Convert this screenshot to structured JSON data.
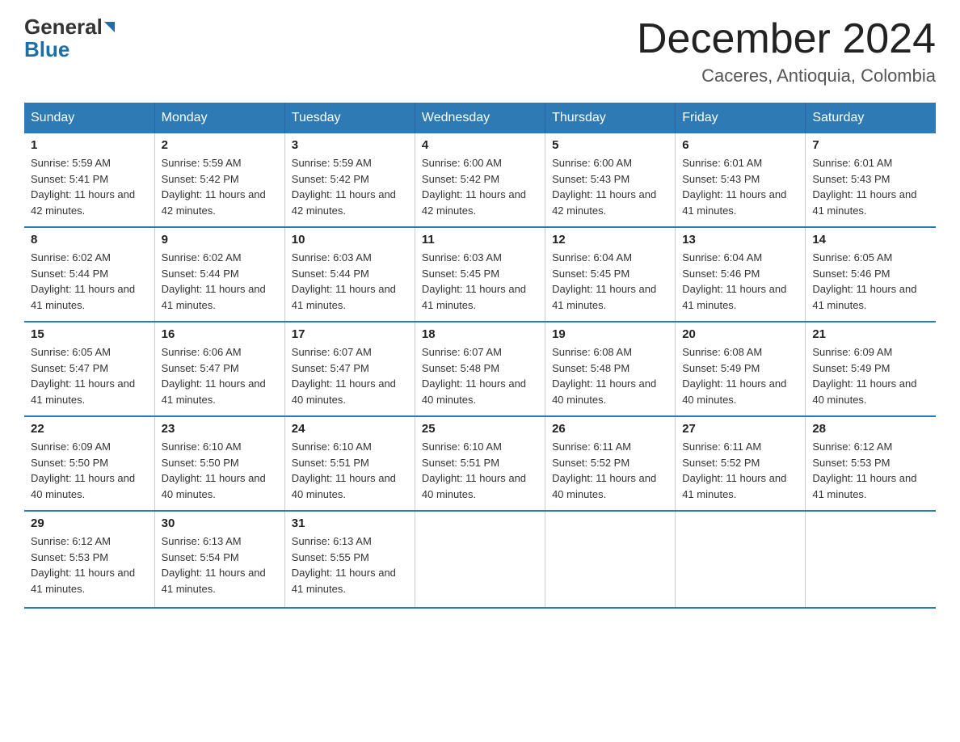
{
  "logo": {
    "general": "General",
    "blue": "Blue"
  },
  "title": "December 2024",
  "subtitle": "Caceres, Antioquia, Colombia",
  "headers": [
    "Sunday",
    "Monday",
    "Tuesday",
    "Wednesday",
    "Thursday",
    "Friday",
    "Saturday"
  ],
  "weeks": [
    [
      {
        "day": "1",
        "info": "Sunrise: 5:59 AM\nSunset: 5:41 PM\nDaylight: 11 hours and 42 minutes."
      },
      {
        "day": "2",
        "info": "Sunrise: 5:59 AM\nSunset: 5:42 PM\nDaylight: 11 hours and 42 minutes."
      },
      {
        "day": "3",
        "info": "Sunrise: 5:59 AM\nSunset: 5:42 PM\nDaylight: 11 hours and 42 minutes."
      },
      {
        "day": "4",
        "info": "Sunrise: 6:00 AM\nSunset: 5:42 PM\nDaylight: 11 hours and 42 minutes."
      },
      {
        "day": "5",
        "info": "Sunrise: 6:00 AM\nSunset: 5:43 PM\nDaylight: 11 hours and 42 minutes."
      },
      {
        "day": "6",
        "info": "Sunrise: 6:01 AM\nSunset: 5:43 PM\nDaylight: 11 hours and 41 minutes."
      },
      {
        "day": "7",
        "info": "Sunrise: 6:01 AM\nSunset: 5:43 PM\nDaylight: 11 hours and 41 minutes."
      }
    ],
    [
      {
        "day": "8",
        "info": "Sunrise: 6:02 AM\nSunset: 5:44 PM\nDaylight: 11 hours and 41 minutes."
      },
      {
        "day": "9",
        "info": "Sunrise: 6:02 AM\nSunset: 5:44 PM\nDaylight: 11 hours and 41 minutes."
      },
      {
        "day": "10",
        "info": "Sunrise: 6:03 AM\nSunset: 5:44 PM\nDaylight: 11 hours and 41 minutes."
      },
      {
        "day": "11",
        "info": "Sunrise: 6:03 AM\nSunset: 5:45 PM\nDaylight: 11 hours and 41 minutes."
      },
      {
        "day": "12",
        "info": "Sunrise: 6:04 AM\nSunset: 5:45 PM\nDaylight: 11 hours and 41 minutes."
      },
      {
        "day": "13",
        "info": "Sunrise: 6:04 AM\nSunset: 5:46 PM\nDaylight: 11 hours and 41 minutes."
      },
      {
        "day": "14",
        "info": "Sunrise: 6:05 AM\nSunset: 5:46 PM\nDaylight: 11 hours and 41 minutes."
      }
    ],
    [
      {
        "day": "15",
        "info": "Sunrise: 6:05 AM\nSunset: 5:47 PM\nDaylight: 11 hours and 41 minutes."
      },
      {
        "day": "16",
        "info": "Sunrise: 6:06 AM\nSunset: 5:47 PM\nDaylight: 11 hours and 41 minutes."
      },
      {
        "day": "17",
        "info": "Sunrise: 6:07 AM\nSunset: 5:47 PM\nDaylight: 11 hours and 40 minutes."
      },
      {
        "day": "18",
        "info": "Sunrise: 6:07 AM\nSunset: 5:48 PM\nDaylight: 11 hours and 40 minutes."
      },
      {
        "day": "19",
        "info": "Sunrise: 6:08 AM\nSunset: 5:48 PM\nDaylight: 11 hours and 40 minutes."
      },
      {
        "day": "20",
        "info": "Sunrise: 6:08 AM\nSunset: 5:49 PM\nDaylight: 11 hours and 40 minutes."
      },
      {
        "day": "21",
        "info": "Sunrise: 6:09 AM\nSunset: 5:49 PM\nDaylight: 11 hours and 40 minutes."
      }
    ],
    [
      {
        "day": "22",
        "info": "Sunrise: 6:09 AM\nSunset: 5:50 PM\nDaylight: 11 hours and 40 minutes."
      },
      {
        "day": "23",
        "info": "Sunrise: 6:10 AM\nSunset: 5:50 PM\nDaylight: 11 hours and 40 minutes."
      },
      {
        "day": "24",
        "info": "Sunrise: 6:10 AM\nSunset: 5:51 PM\nDaylight: 11 hours and 40 minutes."
      },
      {
        "day": "25",
        "info": "Sunrise: 6:10 AM\nSunset: 5:51 PM\nDaylight: 11 hours and 40 minutes."
      },
      {
        "day": "26",
        "info": "Sunrise: 6:11 AM\nSunset: 5:52 PM\nDaylight: 11 hours and 40 minutes."
      },
      {
        "day": "27",
        "info": "Sunrise: 6:11 AM\nSunset: 5:52 PM\nDaylight: 11 hours and 41 minutes."
      },
      {
        "day": "28",
        "info": "Sunrise: 6:12 AM\nSunset: 5:53 PM\nDaylight: 11 hours and 41 minutes."
      }
    ],
    [
      {
        "day": "29",
        "info": "Sunrise: 6:12 AM\nSunset: 5:53 PM\nDaylight: 11 hours and 41 minutes."
      },
      {
        "day": "30",
        "info": "Sunrise: 6:13 AM\nSunset: 5:54 PM\nDaylight: 11 hours and 41 minutes."
      },
      {
        "day": "31",
        "info": "Sunrise: 6:13 AM\nSunset: 5:55 PM\nDaylight: 11 hours and 41 minutes."
      },
      {
        "day": "",
        "info": ""
      },
      {
        "day": "",
        "info": ""
      },
      {
        "day": "",
        "info": ""
      },
      {
        "day": "",
        "info": ""
      }
    ]
  ]
}
